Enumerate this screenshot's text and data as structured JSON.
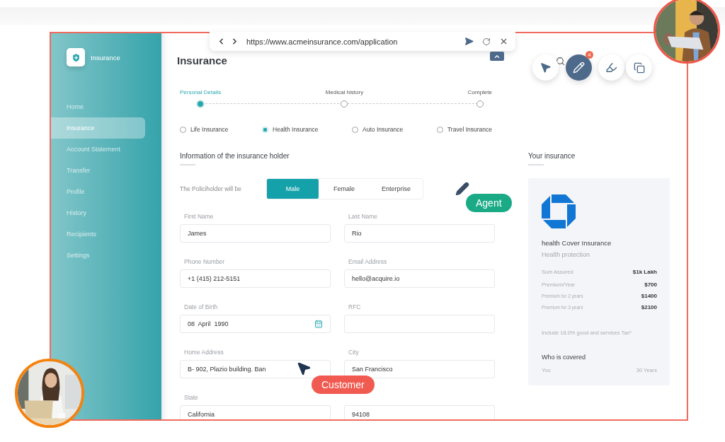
{
  "browser": {
    "url": "https://www.acmeinsurance.com/application"
  },
  "sidebar": {
    "brand": "Insurance",
    "items": [
      {
        "label": "Home",
        "selected": false
      },
      {
        "label": "Insurance",
        "selected": true
      },
      {
        "label": "Account Statement",
        "selected": false
      },
      {
        "label": "Transfer",
        "selected": false
      },
      {
        "label": "Profile",
        "selected": false
      },
      {
        "label": "History",
        "selected": false
      },
      {
        "label": "Recipients",
        "selected": false
      },
      {
        "label": "Settings",
        "selected": false
      }
    ]
  },
  "page_title": "Insurance",
  "stepper": [
    {
      "label": "Personal Details",
      "selected": true
    },
    {
      "label": "Medical history",
      "selected": false
    },
    {
      "label": "Complete",
      "selected": false
    }
  ],
  "insurance_types": [
    {
      "label": "Life Insurance",
      "selected": false
    },
    {
      "label": "Health Insurance",
      "selected": true
    },
    {
      "label": "Auto Insurance",
      "selected": false
    },
    {
      "label": "Travel Insurance",
      "selected": false
    }
  ],
  "holder_form": {
    "title": "Information of the insurance holder",
    "policyholder_label": "The Policiholder will be",
    "policyholder_options": [
      {
        "label": "Male",
        "selected": true
      },
      {
        "label": "Female",
        "selected": false
      },
      {
        "label": "Enterprise",
        "selected": false
      }
    ],
    "fields": [
      {
        "kind": "text",
        "label": "First Name",
        "value": "James"
      },
      {
        "kind": "text",
        "label": "Last Name",
        "value": "Rio"
      },
      {
        "kind": "text",
        "label": "Phone Number",
        "value": "+1 (415) 212-5151"
      },
      {
        "kind": "text",
        "label": "Email Address",
        "value": "hello@acquire.io"
      },
      {
        "kind": "date",
        "label": "Date of Birth",
        "value": "08  April  1990"
      },
      {
        "kind": "text",
        "label": "RFC"
      },
      {
        "kind": "text",
        "label": "Home Address",
        "value": "B- 902, Plazio building. Ban"
      },
      {
        "kind": "text",
        "label": "City",
        "value": "San Francisco"
      },
      {
        "kind": "text",
        "label": "State",
        "value": "California"
      },
      {
        "kind": "text",
        "value": "94108"
      }
    ]
  },
  "summary": {
    "title": "Your insurance",
    "product": "health Cover Insurance",
    "subtitle": "Health protection",
    "rows": [
      {
        "kind": "main",
        "label": "Sum Assured",
        "value": "$1k Lakh"
      },
      {
        "kind": "main",
        "label": "Premium/Year",
        "value": "$700"
      },
      {
        "kind": "minor",
        "label": "Premium for 2 years",
        "value": "$1400"
      },
      {
        "kind": "minor",
        "label": "Premium for 3 years",
        "value": "$2100"
      }
    ],
    "note": "Include 18.0% good and services Tax*",
    "covered_title": "Who is covered",
    "covered": {
      "label": "You",
      "value": "30 Years"
    }
  },
  "toolbar": [
    {
      "kind": "cursor",
      "selected": false
    },
    {
      "kind": "pen",
      "selected": true,
      "badge": "4"
    },
    {
      "kind": "marker",
      "selected": false
    },
    {
      "kind": "copy",
      "selected": false
    }
  ],
  "participants": [
    {
      "kind": "agent",
      "label": "Agent",
      "color": "#1aab86"
    },
    {
      "kind": "customer",
      "label": "Customer",
      "color": "#f15a50"
    }
  ]
}
